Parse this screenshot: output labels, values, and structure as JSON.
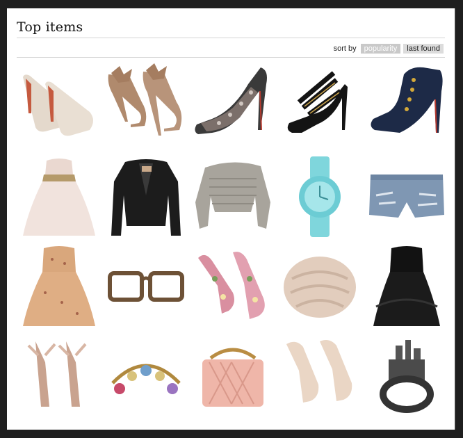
{
  "page": {
    "title": "Top items"
  },
  "sort": {
    "label": "sort by",
    "options": [
      {
        "label": "popularity",
        "active": true
      },
      {
        "label": "last found",
        "active": false
      }
    ]
  },
  "items": [
    {
      "icon": "nude-peep-toe-pumps-icon"
    },
    {
      "icon": "bow-heel-booties-icon"
    },
    {
      "icon": "lace-platform-pump-icon"
    },
    {
      "icon": "black-strappy-sandals-icon"
    },
    {
      "icon": "navy-button-booties-icon"
    },
    {
      "icon": "blush-tulle-dress-icon"
    },
    {
      "icon": "black-leather-jacket-icon"
    },
    {
      "icon": "grey-knit-sweater-icon"
    },
    {
      "icon": "aqua-watch-icon"
    },
    {
      "icon": "distressed-denim-shorts-icon"
    },
    {
      "icon": "floral-strapless-dress-icon"
    },
    {
      "icon": "tortoise-glasses-icon"
    },
    {
      "icon": "floral-platform-pumps-icon"
    },
    {
      "icon": "knit-scarf-icon"
    },
    {
      "icon": "black-ruffle-dress-icon"
    },
    {
      "icon": "ribbon-tie-heels-icon"
    },
    {
      "icon": "charm-bracelet-icon"
    },
    {
      "icon": "pink-quilted-bag-icon"
    },
    {
      "icon": "nude-wrap-heels-icon"
    },
    {
      "icon": "city-skyline-ring-icon"
    }
  ]
}
